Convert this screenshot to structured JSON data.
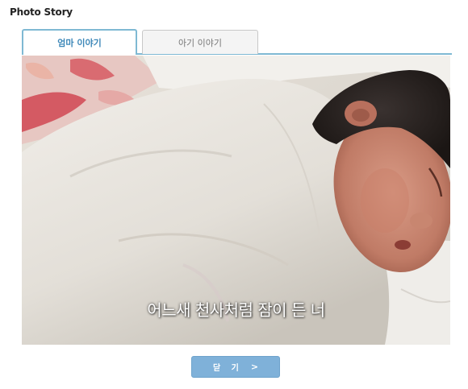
{
  "page_title": "Photo Story",
  "tabs": [
    {
      "label": "엄마 이야기",
      "active": true
    },
    {
      "label": "아기 이야기",
      "active": false
    }
  ],
  "photo": {
    "caption": "어느새 천사처럼 잠이 든 너"
  },
  "close_button": {
    "label": "닫 기",
    "arrow": ">"
  },
  "colors": {
    "accent": "#7fb9d3",
    "button": "#7fb1d9",
    "active_tab_text": "#3c87b8"
  }
}
